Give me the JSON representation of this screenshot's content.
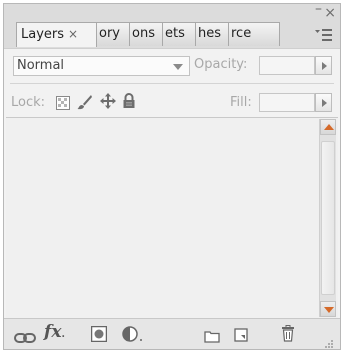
{
  "window_controls": {
    "minimize": "–",
    "close": "×"
  },
  "tabs": [
    {
      "label": "Layers",
      "close": "×",
      "active": true
    },
    {
      "label": "ory"
    },
    {
      "label": "ons"
    },
    {
      "label": "ets"
    },
    {
      "label": "hes"
    },
    {
      "label": "rce"
    }
  ],
  "panel_menu": {
    "icon": "panel-menu-icon"
  },
  "blend_mode": {
    "value": "Normal"
  },
  "opacity": {
    "label": "Opacity:",
    "value": ""
  },
  "lock": {
    "label": "Lock:"
  },
  "fill": {
    "label": "Fill:",
    "value": ""
  },
  "bottom_icons": [
    "link-layers-icon",
    "layer-style-fx-icon",
    "add-mask-icon",
    "adjustment-layer-icon",
    "new-group-folder-icon",
    "new-layer-icon",
    "delete-trash-icon"
  ],
  "fx_text": "fx",
  "colors": {
    "panel_bg": "#e9e9e9",
    "content_bg": "#f2f2f2",
    "disabled_text": "#a8a8a8",
    "accent_orange": "#d56a2a"
  }
}
